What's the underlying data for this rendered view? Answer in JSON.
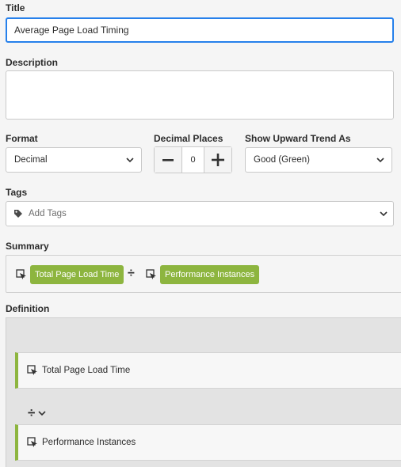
{
  "title_field": {
    "label": "Title",
    "value": "Average Page Load Timing"
  },
  "description_field": {
    "label": "Description",
    "value": ""
  },
  "format_field": {
    "label": "Format",
    "value": "Decimal"
  },
  "decimal_field": {
    "label": "Decimal Places",
    "value": "0",
    "minus": "—",
    "plus": "+"
  },
  "trend_field": {
    "label": "Show Upward Trend As",
    "value": "Good (Green)"
  },
  "tags_field": {
    "label": "Tags",
    "placeholder": "Add Tags"
  },
  "summary": {
    "label": "Summary",
    "operand1": "Total Page Load Time",
    "operator": "÷",
    "operand2": "Performance Instances"
  },
  "definition": {
    "label": "Definition",
    "operand1": "Total Page Load Time",
    "operator": "÷",
    "operand2": "Performance Instances"
  },
  "colors": {
    "accent": "#2680eb",
    "segment": "#8db53f"
  },
  "icons": [
    "chevron-down-icon",
    "tag-icon",
    "segment-cursor-icon",
    "divide-icon",
    "minus-icon",
    "plus-icon"
  ]
}
